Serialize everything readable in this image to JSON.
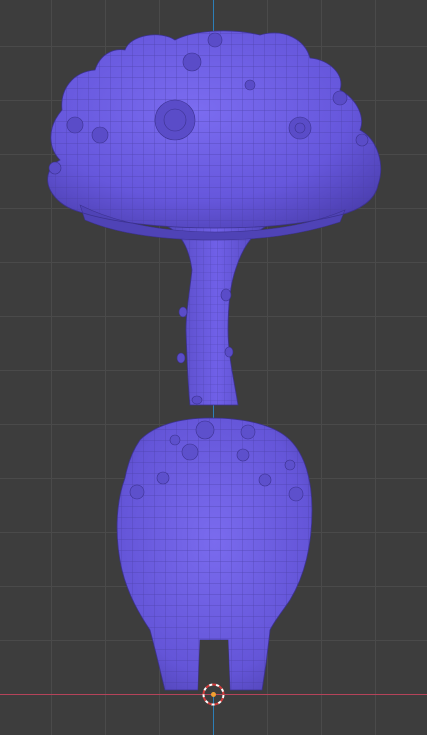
{
  "viewport": {
    "view": "front-orthographic",
    "background_color": "#3d3d3d",
    "grid_color": "#4a4a4a",
    "x_axis_color": "#b5435a",
    "z_axis_color": "#2d7fb8",
    "mesh_color": "#6c5ce0",
    "wire_color": "#4a3fa6",
    "shading": "solid-with-wireframe-overlay",
    "object": "mushroom-creature-mesh",
    "origin_marker": "3d-cursor-icon"
  }
}
